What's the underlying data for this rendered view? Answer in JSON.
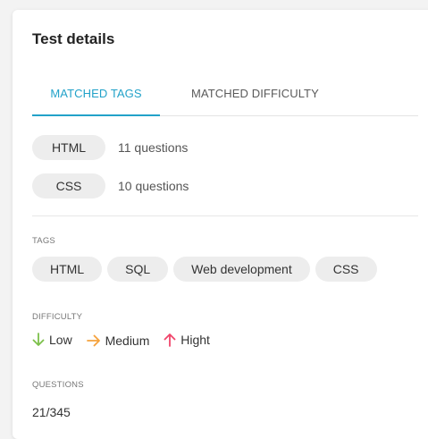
{
  "panel": {
    "title": "Test details"
  },
  "tabs": [
    {
      "label": "MATCHED TAGS",
      "active": true
    },
    {
      "label": "MATCHED DIFFICULTY",
      "active": false
    }
  ],
  "matched_tags": [
    {
      "tag": "HTML",
      "count_text": "11 questions"
    },
    {
      "tag": "CSS",
      "count_text": "10 questions"
    }
  ],
  "tags_section": {
    "label": "TAGS",
    "items": [
      "HTML",
      "SQL",
      "Web development",
      "CSS"
    ]
  },
  "difficulty_section": {
    "label": "DIFFICULTY",
    "items": [
      {
        "label": "Low",
        "icon": "arrow-down-icon",
        "color": "#7cc04a"
      },
      {
        "label": "Medium",
        "icon": "arrow-right-icon",
        "color": "#f5a23c"
      },
      {
        "label": "Hight",
        "icon": "arrow-up-icon",
        "color": "#f0456b"
      }
    ]
  },
  "questions_section": {
    "label": "QUESTIONS",
    "value": "21/345"
  },
  "colors": {
    "accent": "#22a2c9",
    "pill_bg": "#ededed"
  }
}
